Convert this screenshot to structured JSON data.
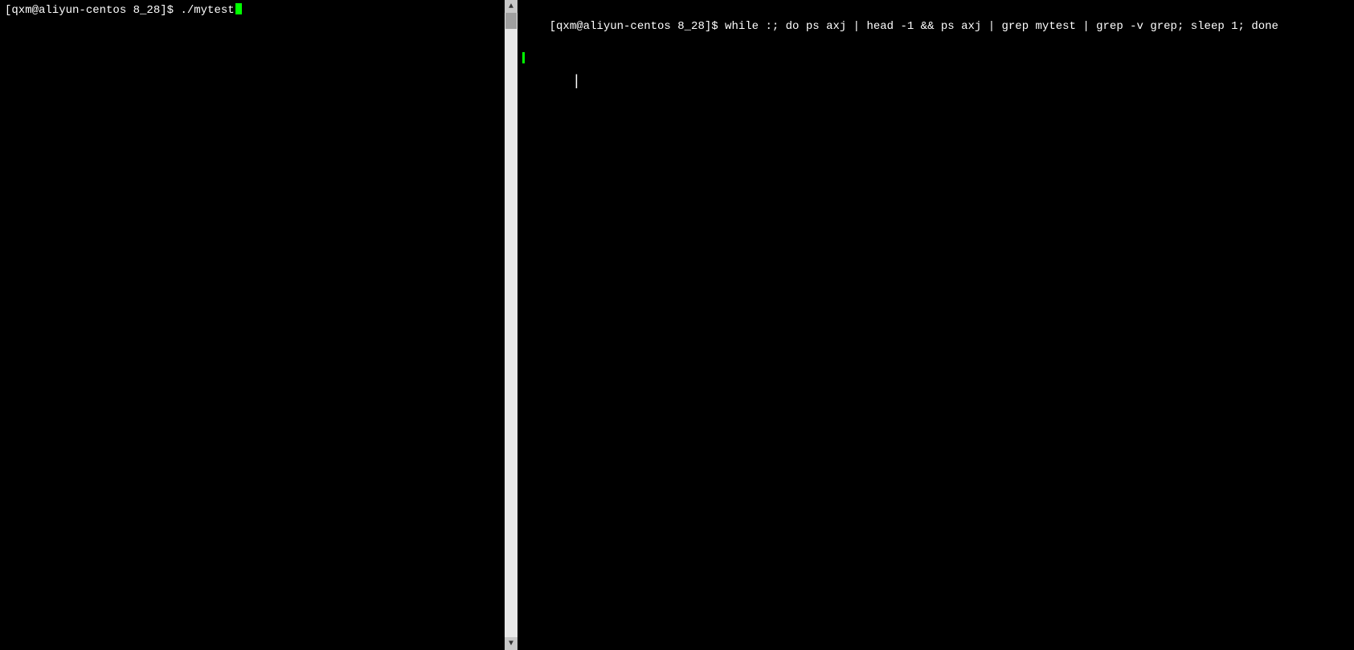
{
  "left_terminal": {
    "prompt": "[qxm@aliyun-centos 8_28]$ ",
    "command": "./mytest"
  },
  "right_terminal": {
    "prompt": "[qxm@aliyun-centos 8_28]$ ",
    "command": "while :; do ps axj | head -1 && ps axj | grep mytest | grep -v grep; sleep 1; done"
  },
  "scrollbar": {
    "up_arrow": "▲",
    "down_arrow": "▼"
  }
}
